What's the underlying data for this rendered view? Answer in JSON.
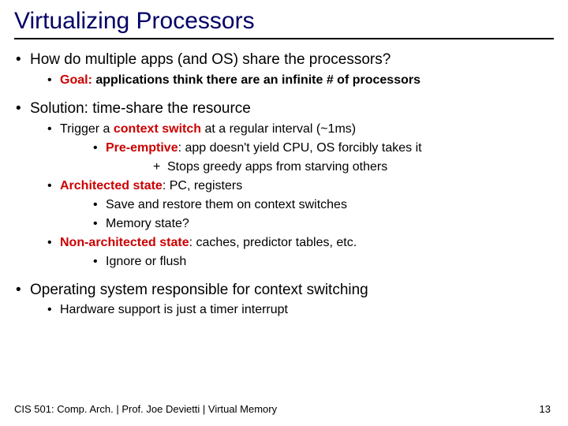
{
  "title": "Virtualizing Processors",
  "b1": {
    "q": "How do multiple apps (and OS) share the processors?",
    "goal_label": "Goal:",
    "goal_text": " applications think there are an infinite # of processors"
  },
  "b2": {
    "sol": "Solution: time-share the resource",
    "trig1": "Trigger a ",
    "trig_red": "context switch",
    "trig2": " at a regular interval (~1ms)",
    "pre_label": "Pre-emptive",
    "pre_text": ": app doesn't yield CPU, OS forcibly takes it",
    "stop": "Stops greedy apps from starving others",
    "arch_label": "Architected state",
    "arch_text": ": PC, registers",
    "arch_sub1": "Save and restore them on context switches",
    "arch_sub2": "Memory state?",
    "nonarch_label": "Non-architected state",
    "nonarch_text": ": caches, predictor tables, etc.",
    "nonarch_sub": "Ignore or flush"
  },
  "b3": {
    "os": "Operating system responsible for context switching",
    "hw": "Hardware support is just a timer interrupt"
  },
  "footer": "CIS 501: Comp. Arch.   |   Prof. Joe Devietti   |   Virtual Memory",
  "page": "13"
}
